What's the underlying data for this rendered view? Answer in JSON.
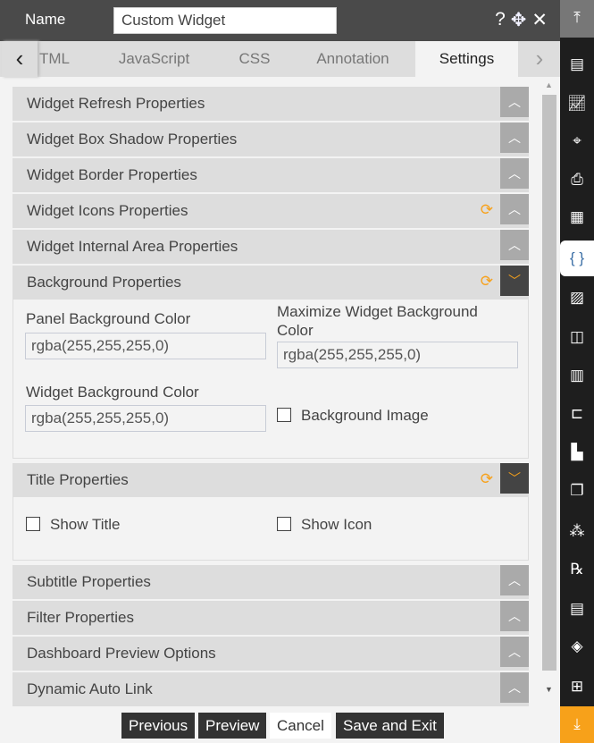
{
  "header": {
    "name_label": "Name",
    "name_value": "Custom Widget",
    "help": "?",
    "move": "✥",
    "close": "✕"
  },
  "tabs": {
    "prev": "‹",
    "next": "›",
    "items": [
      "TML",
      "JavaScript",
      "CSS",
      "Annotation",
      "Settings"
    ],
    "active": "Settings"
  },
  "sections": [
    "Widget Refresh Properties",
    "Widget Box Shadow Properties",
    "Widget Border Properties",
    "Widget Icons Properties",
    "Widget Internal Area Properties",
    "Background Properties",
    "Title Properties",
    "Subtitle Properties",
    "Filter Properties",
    "Dashboard Preview Options",
    "Dynamic Auto Link"
  ],
  "background": {
    "panel_label": "Panel Background Color",
    "panel_value": "rgba(255,255,255,0)",
    "max_label": "Maximize Widget Background Color",
    "max_value": "rgba(255,255,255,0)",
    "widget_label": "Widget Background Color",
    "widget_value": "rgba(255,255,255,0)",
    "image_label": "Background Image"
  },
  "title": {
    "show_title": "Show Title",
    "show_icon": "Show Icon"
  },
  "buttons": {
    "previous": "Previous",
    "preview": "Preview",
    "cancel": "Cancel",
    "save": "Save and Exit"
  },
  "colors": {
    "accent": "#f7a11a",
    "header": "#4a4a4a",
    "sidebar": "#1e1e1e"
  },
  "sidebar_icons": [
    "scroll-top-icon",
    "widget-icon",
    "chart-icon",
    "map-icon",
    "report-icon",
    "document-icon",
    "code-icon",
    "image-icon",
    "frame-icon",
    "calculator-icon",
    "tree-icon",
    "bar-chart-icon",
    "copy-icon",
    "cubes-icon",
    "rx-icon",
    "page-icon",
    "layers-icon",
    "add-widget-icon",
    "scroll-bottom-icon"
  ]
}
